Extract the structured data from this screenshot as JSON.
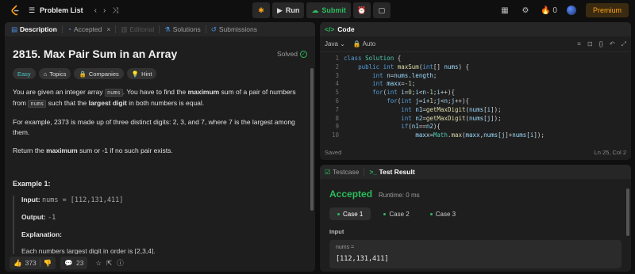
{
  "topbar": {
    "problem_list": "Problem List",
    "run_label": "Run",
    "submit_label": "Submit",
    "streak_count": "0",
    "premium_label": "Premium"
  },
  "left": {
    "tabs": [
      "Description",
      "Accepted",
      "Editorial",
      "Solutions",
      "Submissions"
    ],
    "title": "2815. Max Pair Sum in an Array",
    "status": "Solved",
    "tags": [
      "Easy",
      "Topics",
      "Companies",
      "Hint"
    ],
    "p1_a": "You are given an integer array ",
    "p1_code": "nums",
    "p1_b": ". You have to find the ",
    "p1_bold": "maximum",
    "p1_c": " sum of a pair of numbers from ",
    "p1_code2": "nums",
    "p1_d": " such that the ",
    "p1_bold2": "largest digit",
    "p1_e": " in both numbers is equal.",
    "p2": "For example, 2373 is made up of three distinct digits: 2, 3, and 7, where 7 is the largest among them.",
    "p3_a": "Return the ",
    "p3_bold": "maximum",
    "p3_b": " sum or -1 if no such pair exists.",
    "example_title": "Example 1:",
    "ex_input_label": "Input:",
    "ex_input_val": "nums = [112,131,411]",
    "ex_output_label": "Output:",
    "ex_output_val": "-1",
    "ex_expl_label": "Explanation:",
    "ex_expl_text": "Each numbers largest digit in order is [2,3,4].",
    "likes": "373",
    "comments": "23"
  },
  "code": {
    "header": "Code",
    "language": "Java",
    "mode": "Auto",
    "line_numbers": [
      "1",
      "2",
      "3",
      "4",
      "5",
      "6",
      "7",
      "8",
      "9",
      "10"
    ],
    "saved": "Saved",
    "cursor": "Ln 25, Col 2"
  },
  "result": {
    "tab_testcase": "Testcase",
    "tab_result": "Test Result",
    "verdict": "Accepted",
    "runtime": "Runtime: 0 ms",
    "cases": [
      "Case 1",
      "Case 2",
      "Case 3"
    ],
    "input_label": "Input",
    "input_name": "nums =",
    "input_value": "[112,131,411]"
  }
}
